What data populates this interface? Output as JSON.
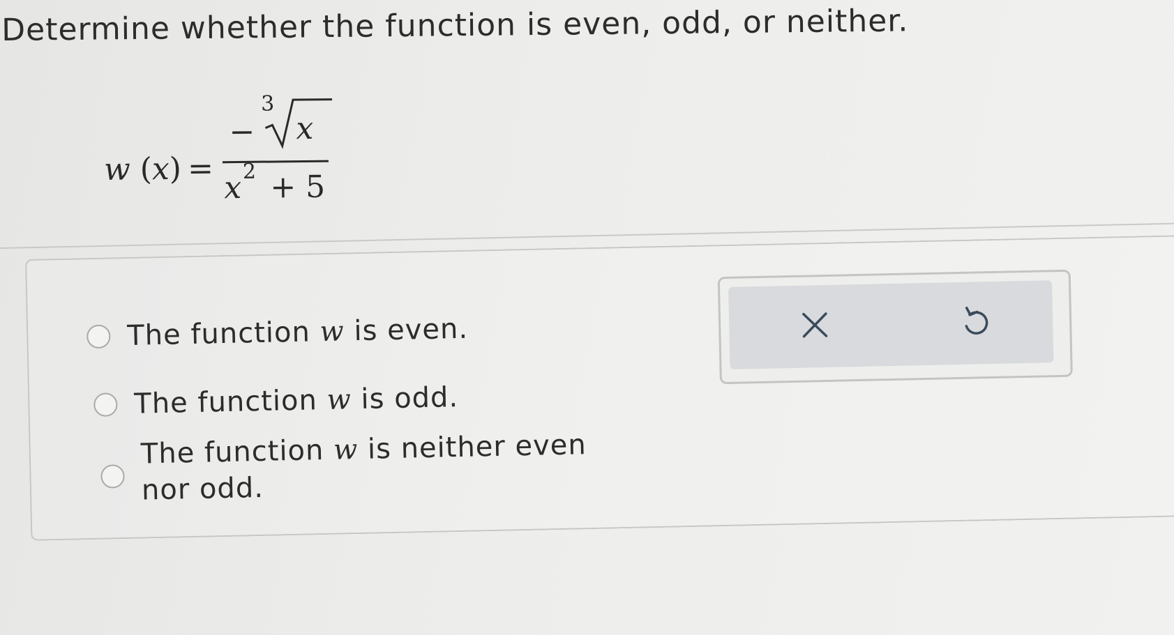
{
  "question": {
    "text": "Determine whether the function is even, odd, or neither."
  },
  "formula": {
    "function_name": "w",
    "variable": "x",
    "equals": "=",
    "numerator_sign": "−",
    "root_index": "3",
    "radicand": "x",
    "denominator_base": "x",
    "denominator_exponent": "2",
    "denominator_plus": "+",
    "denominator_constant": "5"
  },
  "options": [
    {
      "prefix": "The function ",
      "var": "w",
      "suffix": " is even."
    },
    {
      "prefix": "The function ",
      "var": "w",
      "suffix": " is odd."
    },
    {
      "prefix": "The function ",
      "var": "w",
      "suffix": " is neither even nor odd."
    }
  ],
  "toolbar": {
    "clear_icon": "close-icon",
    "undo_icon": "undo-icon"
  },
  "colors": {
    "background": "#ececea",
    "text": "#2c2c2c",
    "toolbar_inner": "#d8dadd"
  }
}
